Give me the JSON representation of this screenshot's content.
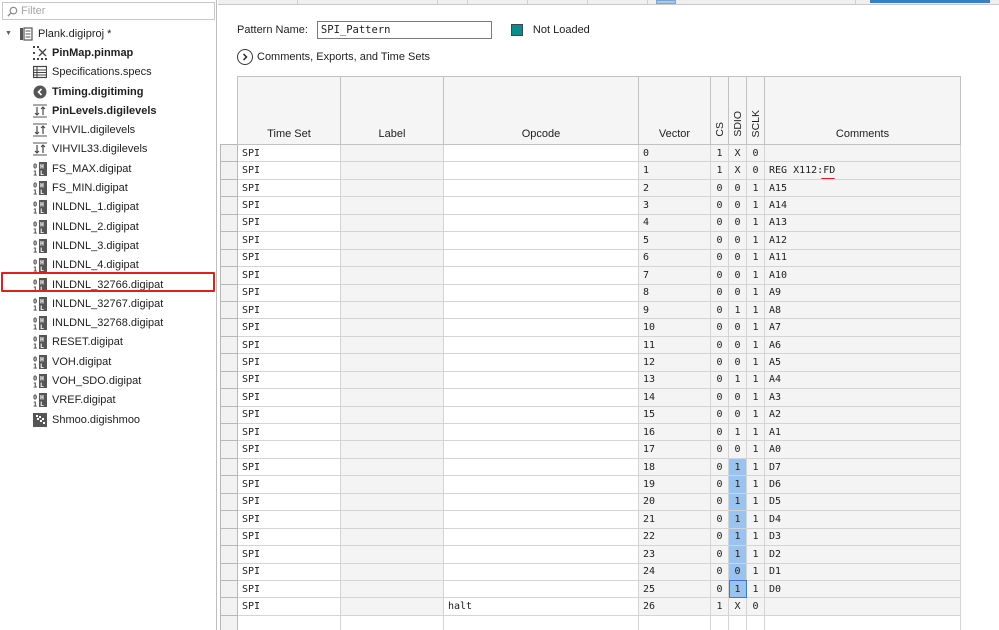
{
  "left_panel": {
    "filter_placeholder": "Filter",
    "project": {
      "label": "Plank.digiproj *",
      "expanded": true,
      "icon": "project-icon"
    },
    "items": [
      {
        "label": "PinMap.pinmap",
        "icon": "pinmap-icon",
        "bold": true
      },
      {
        "label": "Specifications.specs",
        "icon": "specs-table-icon",
        "bold": false
      },
      {
        "label": "Timing.digitiming",
        "icon": "timing-clock-icon",
        "bold": true
      },
      {
        "label": "PinLevels.digilevels",
        "icon": "levels-icon",
        "bold": true
      },
      {
        "label": "VIHVIL.digilevels",
        "icon": "levels-icon",
        "bold": false
      },
      {
        "label": "VIHVIL33.digilevels",
        "icon": "levels-icon",
        "bold": false
      },
      {
        "label": "FS_MAX.digipat",
        "icon": "pattern-icon",
        "bold": false
      },
      {
        "label": "FS_MIN.digipat",
        "icon": "pattern-icon",
        "bold": false
      },
      {
        "label": "INLDNL_1.digipat",
        "icon": "pattern-icon",
        "bold": false
      },
      {
        "label": "INLDNL_2.digipat",
        "icon": "pattern-icon",
        "bold": false
      },
      {
        "label": "INLDNL_3.digipat",
        "icon": "pattern-icon",
        "bold": false
      },
      {
        "label": "INLDNL_4.digipat",
        "icon": "pattern-icon",
        "bold": false
      },
      {
        "label": "INLDNL_32766.digipat",
        "icon": "pattern-icon",
        "bold": false,
        "highlighted": true
      },
      {
        "label": "INLDNL_32767.digipat",
        "icon": "pattern-icon",
        "bold": false
      },
      {
        "label": "INLDNL_32768.digipat",
        "icon": "pattern-icon",
        "bold": false
      },
      {
        "label": "RESET.digipat",
        "icon": "pattern-icon",
        "bold": false
      },
      {
        "label": "VOH.digipat",
        "icon": "pattern-icon",
        "bold": false
      },
      {
        "label": "VOH_SDO.digipat",
        "icon": "pattern-icon",
        "bold": false
      },
      {
        "label": "VREF.digipat",
        "icon": "pattern-icon",
        "bold": false
      },
      {
        "label": "Shmoo.digishmoo",
        "icon": "shmoo-icon",
        "bold": false
      }
    ]
  },
  "editor": {
    "pattern_name_label": "Pattern Name:",
    "pattern_name_value": "SPI_Pattern",
    "status_label": "Not Loaded",
    "status_color": "#0f8a88",
    "expander_label": "Comments, Exports, and Time Sets",
    "columns": {
      "time_set": "Time Set",
      "label": "Label",
      "opcode": "Opcode",
      "vector": "Vector",
      "cs": "CS",
      "sdio": "SDIO",
      "sclk": "SCLK",
      "comments": "Comments"
    },
    "rows": [
      {
        "time_set": "SPI",
        "label": "",
        "opcode": "",
        "vector": "0",
        "cs": "1",
        "sdio": "X",
        "sclk": "0",
        "comment": ""
      },
      {
        "time_set": "SPI",
        "label": "",
        "opcode": "",
        "vector": "1",
        "cs": "1",
        "sdio": "X",
        "sclk": "0",
        "comment": "REG X112:",
        "comment_underlined": "FD"
      },
      {
        "time_set": "SPI",
        "label": "",
        "opcode": "",
        "vector": "2",
        "cs": "0",
        "sdio": "0",
        "sclk": "1",
        "comment": "A15"
      },
      {
        "time_set": "SPI",
        "label": "",
        "opcode": "",
        "vector": "3",
        "cs": "0",
        "sdio": "0",
        "sclk": "1",
        "comment": "A14"
      },
      {
        "time_set": "SPI",
        "label": "",
        "opcode": "",
        "vector": "4",
        "cs": "0",
        "sdio": "0",
        "sclk": "1",
        "comment": "A13"
      },
      {
        "time_set": "SPI",
        "label": "",
        "opcode": "",
        "vector": "5",
        "cs": "0",
        "sdio": "0",
        "sclk": "1",
        "comment": "A12"
      },
      {
        "time_set": "SPI",
        "label": "",
        "opcode": "",
        "vector": "6",
        "cs": "0",
        "sdio": "0",
        "sclk": "1",
        "comment": "A11"
      },
      {
        "time_set": "SPI",
        "label": "",
        "opcode": "",
        "vector": "7",
        "cs": "0",
        "sdio": "0",
        "sclk": "1",
        "comment": "A10"
      },
      {
        "time_set": "SPI",
        "label": "",
        "opcode": "",
        "vector": "8",
        "cs": "0",
        "sdio": "0",
        "sclk": "1",
        "comment": "A9"
      },
      {
        "time_set": "SPI",
        "label": "",
        "opcode": "",
        "vector": "9",
        "cs": "0",
        "sdio": "1",
        "sclk": "1",
        "comment": "A8"
      },
      {
        "time_set": "SPI",
        "label": "",
        "opcode": "",
        "vector": "10",
        "cs": "0",
        "sdio": "0",
        "sclk": "1",
        "comment": "A7"
      },
      {
        "time_set": "SPI",
        "label": "",
        "opcode": "",
        "vector": "11",
        "cs": "0",
        "sdio": "0",
        "sclk": "1",
        "comment": "A6"
      },
      {
        "time_set": "SPI",
        "label": "",
        "opcode": "",
        "vector": "12",
        "cs": "0",
        "sdio": "0",
        "sclk": "1",
        "comment": "A5"
      },
      {
        "time_set": "SPI",
        "label": "",
        "opcode": "",
        "vector": "13",
        "cs": "0",
        "sdio": "1",
        "sclk": "1",
        "comment": "A4"
      },
      {
        "time_set": "SPI",
        "label": "",
        "opcode": "",
        "vector": "14",
        "cs": "0",
        "sdio": "0",
        "sclk": "1",
        "comment": "A3"
      },
      {
        "time_set": "SPI",
        "label": "",
        "opcode": "",
        "vector": "15",
        "cs": "0",
        "sdio": "0",
        "sclk": "1",
        "comment": "A2"
      },
      {
        "time_set": "SPI",
        "label": "",
        "opcode": "",
        "vector": "16",
        "cs": "0",
        "sdio": "1",
        "sclk": "1",
        "comment": "A1"
      },
      {
        "time_set": "SPI",
        "label": "",
        "opcode": "",
        "vector": "17",
        "cs": "0",
        "sdio": "0",
        "sclk": "1",
        "comment": "A0"
      },
      {
        "time_set": "SPI",
        "label": "",
        "opcode": "",
        "vector": "18",
        "cs": "0",
        "sdio": "1",
        "sclk": "1",
        "comment": "D7",
        "sdio_selected": true
      },
      {
        "time_set": "SPI",
        "label": "",
        "opcode": "",
        "vector": "19",
        "cs": "0",
        "sdio": "1",
        "sclk": "1",
        "comment": "D6",
        "sdio_selected": true
      },
      {
        "time_set": "SPI",
        "label": "",
        "opcode": "",
        "vector": "20",
        "cs": "0",
        "sdio": "1",
        "sclk": "1",
        "comment": "D5",
        "sdio_selected": true
      },
      {
        "time_set": "SPI",
        "label": "",
        "opcode": "",
        "vector": "21",
        "cs": "0",
        "sdio": "1",
        "sclk": "1",
        "comment": "D4",
        "sdio_selected": true
      },
      {
        "time_set": "SPI",
        "label": "",
        "opcode": "",
        "vector": "22",
        "cs": "0",
        "sdio": "1",
        "sclk": "1",
        "comment": "D3",
        "sdio_selected": true
      },
      {
        "time_set": "SPI",
        "label": "",
        "opcode": "",
        "vector": "23",
        "cs": "0",
        "sdio": "1",
        "sclk": "1",
        "comment": "D2",
        "sdio_selected": true
      },
      {
        "time_set": "SPI",
        "label": "",
        "opcode": "",
        "vector": "24",
        "cs": "0",
        "sdio": "0",
        "sclk": "1",
        "comment": "D1",
        "sdio_selected": true
      },
      {
        "time_set": "SPI",
        "label": "",
        "opcode": "",
        "vector": "25",
        "cs": "0",
        "sdio": "1",
        "sclk": "1",
        "comment": "D0",
        "sdio_selected": true,
        "sdio_focused": true
      },
      {
        "time_set": "SPI",
        "label": "",
        "opcode": "halt",
        "vector": "26",
        "cs": "1",
        "sdio": "X",
        "sclk": "0",
        "comment": ""
      }
    ]
  }
}
